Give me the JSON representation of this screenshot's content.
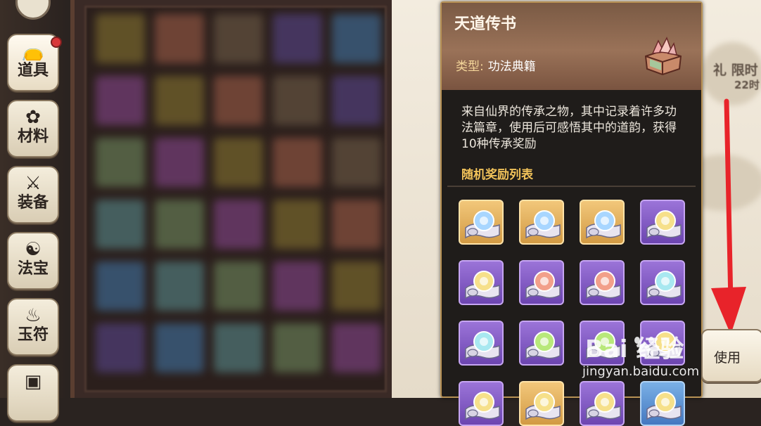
{
  "sidebar": {
    "tabs": [
      {
        "label": "道具",
        "icon": "bag-icon",
        "active": true
      },
      {
        "label": "材料",
        "icon": "herb-icon"
      },
      {
        "label": "装备",
        "icon": "armor-icon"
      },
      {
        "label": "法宝",
        "icon": "treasure-icon"
      },
      {
        "label": "玉符",
        "icon": "talisman-icon"
      },
      {
        "label": "",
        "icon": "chest-icon"
      }
    ]
  },
  "background_text": {
    "line1": "礼  限时",
    "line2": "22时"
  },
  "item_detail": {
    "name": "天道传书",
    "type_label": "类型:",
    "type_value": "功法典籍",
    "description": "来自仙界的传承之物，其中记录着许多功法篇章，使用后可感悟其中的道韵，获得10种传承奖励",
    "reward_list_title": "随机奖励列表",
    "rewards": [
      {
        "rarity": "gold",
        "orb": "blue"
      },
      {
        "rarity": "gold",
        "orb": "blue"
      },
      {
        "rarity": "gold",
        "orb": "blue"
      },
      {
        "rarity": "purple",
        "orb": "yellow"
      },
      {
        "rarity": "purple",
        "orb": "yellow"
      },
      {
        "rarity": "purple",
        "orb": "red"
      },
      {
        "rarity": "purple",
        "orb": "red"
      },
      {
        "rarity": "purple",
        "orb": "cyan"
      },
      {
        "rarity": "purple",
        "orb": "cyan"
      },
      {
        "rarity": "purple",
        "orb": "green"
      },
      {
        "rarity": "purple",
        "orb": "green"
      },
      {
        "rarity": "purple",
        "orb": "yellow"
      }
    ]
  },
  "use_button": {
    "label": "使用"
  },
  "watermark": {
    "brand": "Bai 经验",
    "url": "jingyan.baidu.com"
  },
  "colors": {
    "panel_border": "#b89255",
    "reward_title": "#f2c35a",
    "arrow": "#e8232a"
  }
}
